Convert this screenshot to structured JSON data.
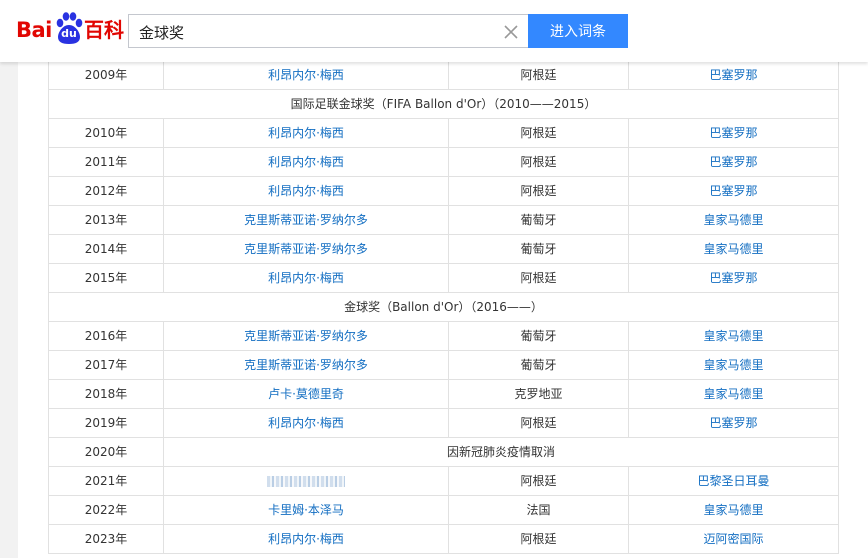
{
  "header": {
    "logo": {
      "bai": "Bai",
      "du": "du",
      "baike": "百科"
    },
    "search_value": "金球奖",
    "search_button": "进入词条"
  },
  "table": {
    "rows": [
      {
        "type": "data",
        "year": "2009年",
        "player": "利昂内尔·梅西",
        "country": "阿根廷",
        "club": "巴塞罗那"
      },
      {
        "type": "section",
        "text": "国际足联金球奖（FIFA Ballon d'Or）（2010——2015）"
      },
      {
        "type": "data",
        "year": "2010年",
        "player": "利昂内尔·梅西",
        "country": "阿根廷",
        "club": "巴塞罗那"
      },
      {
        "type": "data",
        "year": "2011年",
        "player": "利昂内尔·梅西",
        "country": "阿根廷",
        "club": "巴塞罗那"
      },
      {
        "type": "data",
        "year": "2012年",
        "player": "利昂内尔·梅西",
        "country": "阿根廷",
        "club": "巴塞罗那"
      },
      {
        "type": "data",
        "year": "2013年",
        "player": "克里斯蒂亚诺·罗纳尔多",
        "country": "葡萄牙",
        "club": "皇家马德里"
      },
      {
        "type": "data",
        "year": "2014年",
        "player": "克里斯蒂亚诺·罗纳尔多",
        "country": "葡萄牙",
        "club": "皇家马德里"
      },
      {
        "type": "data",
        "year": "2015年",
        "player": "利昂内尔·梅西",
        "country": "阿根廷",
        "club": "巴塞罗那"
      },
      {
        "type": "section",
        "text": "金球奖（Ballon d'Or）（2016——）"
      },
      {
        "type": "data",
        "year": "2016年",
        "player": "克里斯蒂亚诺·罗纳尔多",
        "country": "葡萄牙",
        "club": "皇家马德里"
      },
      {
        "type": "data",
        "year": "2017年",
        "player": "克里斯蒂亚诺·罗纳尔多",
        "country": "葡萄牙",
        "club": "皇家马德里"
      },
      {
        "type": "data",
        "year": "2018年",
        "player": "卢卡·莫德里奇",
        "country": "克罗地亚",
        "club": "皇家马德里"
      },
      {
        "type": "data",
        "year": "2019年",
        "player": "利昂内尔·梅西",
        "country": "阿根廷",
        "club": "巴塞罗那"
      },
      {
        "type": "cancelled",
        "year": "2020年",
        "text": "因新冠肺炎疫情取消"
      },
      {
        "type": "data",
        "year": "2021年",
        "player": "",
        "player_blurred": true,
        "country": "阿根廷",
        "club": "巴黎圣日耳曼"
      },
      {
        "type": "data",
        "year": "2022年",
        "player": "卡里姆·本泽马",
        "country": "法国",
        "club": "皇家马德里"
      },
      {
        "type": "data",
        "year": "2023年",
        "player": "利昂内尔·梅西",
        "country": "阿根廷",
        "club": "迈阿密国际"
      }
    ]
  },
  "colors": {
    "logo_red": "#e10602",
    "logo_blue": "#2932e1",
    "button_blue": "#3388ff",
    "link_blue": "#136ec2"
  }
}
